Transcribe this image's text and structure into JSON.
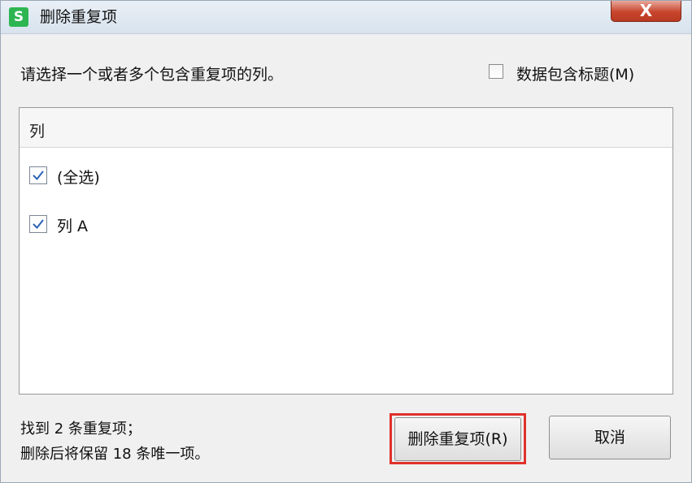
{
  "window": {
    "app_icon_letter": "S",
    "title": "删除重复项",
    "close_label": "X"
  },
  "prompt": "请选择一个或者多个包含重复项的列。",
  "header_checkbox": {
    "label": "数据包含标题(M)",
    "checked": false
  },
  "list": {
    "header": "列",
    "items": [
      {
        "label": "(全选)",
        "checked": true
      },
      {
        "label": "列 A",
        "checked": true
      }
    ]
  },
  "status": {
    "line1": "找到 2 条重复项；",
    "line2": "删除后将保留 18 条唯一项。"
  },
  "buttons": {
    "delete_label": "删除重复项(R)",
    "cancel_label": "取消"
  },
  "colors": {
    "app_icon": "#2db552",
    "close_button": "#c8452d",
    "highlight_border": "#e0312c",
    "checkmark": "#2a62b8"
  }
}
